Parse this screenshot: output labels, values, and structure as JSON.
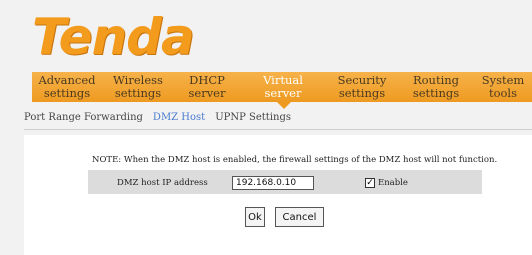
{
  "logo": {
    "text": "Tenda",
    "reg": "®"
  },
  "nav": {
    "items": [
      {
        "line1": "Advanced",
        "line2": "settings",
        "active": false
      },
      {
        "line1": "Wireless",
        "line2": "settings",
        "active": false
      },
      {
        "line1": "DHCP",
        "line2": "server",
        "active": false
      },
      {
        "line1": "Virtual",
        "line2": "server",
        "active": true
      },
      {
        "line1": "Security",
        "line2": "settings",
        "active": false
      },
      {
        "line1": "Routing",
        "line2": "settings",
        "active": false
      },
      {
        "line1": "System",
        "line2": "tools",
        "active": false
      }
    ]
  },
  "subnav": {
    "items": [
      {
        "label": "Port Range Forwarding",
        "active": false
      },
      {
        "label": "DMZ Host",
        "active": true
      },
      {
        "label": "UPNP Settings",
        "active": false
      }
    ]
  },
  "form": {
    "note": "NOTE: When the DMZ host is enabled, the firewall settings of the DMZ host will not function.",
    "dmz_label": "DMZ host IP address",
    "dmz_ip": "192.168.0.10",
    "enable_checked_glyph": "✓",
    "enable_label": "Enable",
    "ok_label": "Ok",
    "cancel_label": "Cancel"
  },
  "colors": {
    "nav_orange": "#ee9a21",
    "logo_orange": "#f29b1d",
    "active_link": "#4a7ad0"
  }
}
